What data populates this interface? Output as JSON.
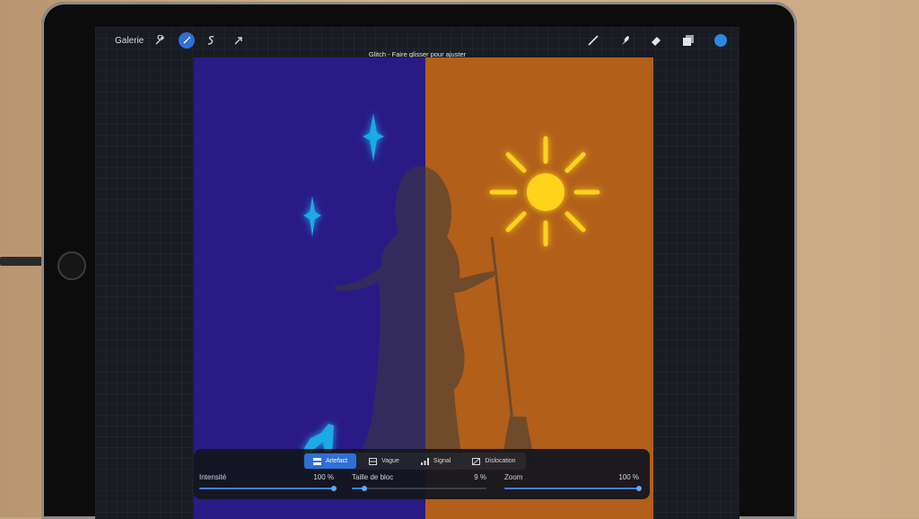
{
  "toolbar": {
    "gallery_label": "Galerie",
    "left_icons": [
      "wrench-icon",
      "magic-wand-icon",
      "selection-s-icon",
      "arrow-transform-icon"
    ],
    "right_icons": [
      "brush-icon",
      "smudge-icon",
      "eraser-icon",
      "layers-icon",
      "color-circle-icon"
    ],
    "color": "#2f86e0"
  },
  "hint_text": "Glitch -  Faire glisser pour ajuster",
  "glitch": {
    "tabs": [
      {
        "label": "Artefact",
        "icon": "artefact-icon",
        "active": true
      },
      {
        "label": "Vague",
        "icon": "wave-icon",
        "active": false
      },
      {
        "label": "Signal",
        "icon": "signal-icon",
        "active": false
      },
      {
        "label": "Dislocation",
        "icon": "dislocation-icon",
        "active": false
      }
    ],
    "sliders": [
      {
        "label": "Intensité",
        "value_text": "100 %",
        "value": 1.0
      },
      {
        "label": "Taille de bloc",
        "value_text": "9 %",
        "value": 0.09
      },
      {
        "label": "Zoom",
        "value_text": "100 %",
        "value": 1.0
      }
    ]
  },
  "colors": {
    "left_bg": "#2a1a86",
    "right_bg": "#b25f1a",
    "accent": "#2f6fd6",
    "moon": "#1aa9e8",
    "sun": "#ffd21a"
  }
}
